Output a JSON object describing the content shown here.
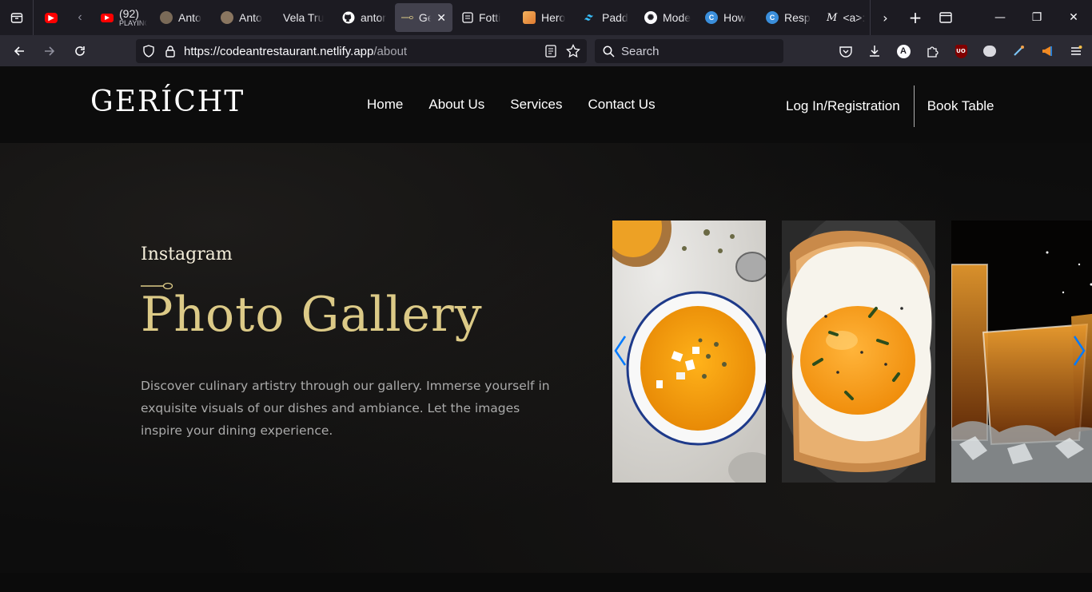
{
  "browser": {
    "tabs": [
      {
        "title": "",
        "sub": "",
        "icon": "youtube-muted-icon"
      },
      {
        "title": "(92) ",
        "sub": "PLAYING",
        "icon": "youtube-icon"
      },
      {
        "title": "Anto",
        "sub": "",
        "icon": "avatar-icon"
      },
      {
        "title": "Anto",
        "sub": "",
        "icon": "avatar-icon"
      },
      {
        "title": "Vela Tru",
        "sub": "",
        "icon": "blank-icon"
      },
      {
        "title": "antor",
        "sub": "",
        "icon": "github-icon"
      },
      {
        "title": "Ge",
        "sub": "",
        "icon": "spoon-icon",
        "active": true
      },
      {
        "title": "Fotti",
        "sub": "",
        "icon": "page-icon"
      },
      {
        "title": "Hero",
        "sub": "",
        "icon": "image-icon"
      },
      {
        "title": "Padd",
        "sub": "",
        "icon": "tailwind-icon"
      },
      {
        "title": "Mode",
        "sub": "",
        "icon": "openai-icon"
      },
      {
        "title": "How",
        "sub": "",
        "icon": "codeium-icon"
      },
      {
        "title": "Resp",
        "sub": "",
        "icon": "codeium-icon"
      },
      {
        "title": "<a>:",
        "sub": "",
        "icon": "mdn-icon"
      }
    ],
    "url_main": "https://codeantrestaurant.netlify.app",
    "url_path": "/about",
    "search_placeholder": "Search"
  },
  "site": {
    "logo": "GERÍCHT",
    "menu": [
      "Home",
      "About Us",
      "Services",
      "Contact Us"
    ],
    "login": "Log In/Registration",
    "book": "Book Table"
  },
  "gallery": {
    "subtitle": "Instagram",
    "headline": "Photo Gallery",
    "description": "Discover culinary artistry through our gallery. Immerse yourself in exquisite visuals of our dishes and ambiance. Let the images inspire your dining experience.",
    "slides": [
      "pumpkin-soup",
      "fried-egg-toast",
      "whiskey-glasses"
    ]
  },
  "colors": {
    "golden": "#dcca87",
    "crimson": "#f5efdb",
    "swiper_arrow": "#007aff"
  }
}
